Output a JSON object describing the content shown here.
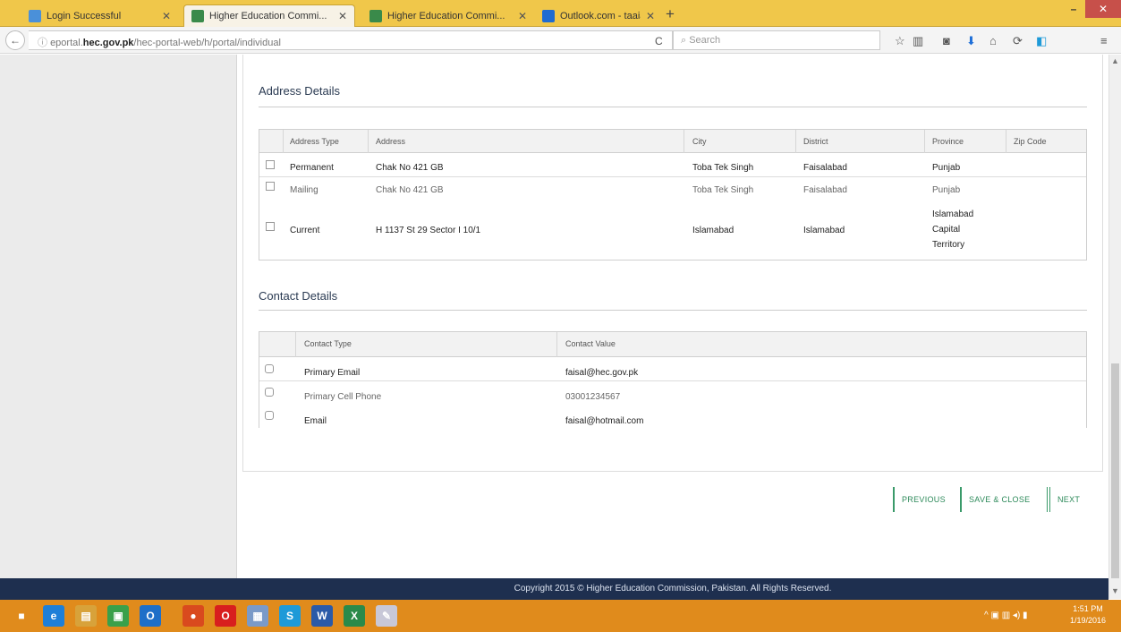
{
  "tabs": [
    {
      "label": "Login Successful",
      "active": false,
      "color": "#4a90d9"
    },
    {
      "label": "Higher Education Commi...",
      "active": true,
      "color": "#3a8a4a"
    },
    {
      "label": "Higher Education Commi...",
      "active": false,
      "color": "#3a8a4a"
    },
    {
      "label": "Outlook.com - taaiaer@ho...",
      "active": false,
      "color": "#1f6bd0"
    }
  ],
  "window": {
    "minimize_label": "–",
    "close_label": "✕"
  },
  "nav": {
    "back_label": "←",
    "url_prefix": "eportal.",
    "url_host": "hec.gov.pk",
    "url_path": "/hec-portal-web/h/portal/individual",
    "reload_label": "C",
    "search_placeholder": "Search"
  },
  "toolbar_icons": [
    "star-icon",
    "reading-list-icon",
    "pocket-icon",
    "download-icon",
    "home-icon",
    "sync-icon",
    "extension-icon",
    "menu-icon"
  ],
  "address": {
    "title": "Address Details",
    "headers": [
      "Address Type",
      "Address",
      "City",
      "District",
      "Province",
      "Zip Code"
    ],
    "rows": [
      {
        "type": "Permanent",
        "address": "Chak No 421 GB",
        "city": "Toba Tek Singh",
        "district": "Faisalabad",
        "province": "Punjab",
        "zip": ""
      },
      {
        "type": "Mailing",
        "address": "Chak No 421 GB",
        "city": "Toba Tek Singh",
        "district": "Faisalabad",
        "province": "Punjab",
        "zip": ""
      },
      {
        "type": "Current",
        "address": "H 1137 St 29 Sector I 10/1",
        "city": "Islamabad",
        "district": "Islamabad",
        "province_line1": "Islamabad",
        "province_line2": "Capital",
        "province_line3": "Territory",
        "zip": ""
      }
    ]
  },
  "contact": {
    "title": "Contact Details",
    "headers": [
      "Contact Type",
      "Contact Value"
    ],
    "rows": [
      {
        "type": "Primary Email",
        "value": "faisal@hec.gov.pk"
      },
      {
        "type": "Primary Cell Phone",
        "value": "03001234567"
      },
      {
        "type": "Email",
        "value": "faisal@hotmail.com"
      }
    ]
  },
  "actions": {
    "previous": "PREVIOUS",
    "save_close": "SAVE & CLOSE",
    "next": "NEXT"
  },
  "footer": {
    "text": "Copyright 2015 © Higher Education Commission, Pakistan. All Rights Reserved."
  },
  "taskbar": {
    "icons": [
      {
        "name": "windows-start-icon",
        "glyph": "■",
        "color": "#e08b1c"
      },
      {
        "name": "internet-explorer-icon",
        "glyph": "e",
        "color": "#1e7fd8"
      },
      {
        "name": "file-explorer-icon",
        "glyph": "▤",
        "color": "#d8a23a"
      },
      {
        "name": "store-icon",
        "glyph": "▣",
        "color": "#3aa04a"
      },
      {
        "name": "outlook-icon",
        "glyph": "O",
        "color": "#1e6fc8"
      },
      {
        "name": "firefox-icon",
        "glyph": "●",
        "color": "#d94a1e"
      },
      {
        "name": "opera-icon",
        "glyph": "O",
        "color": "#d81e1e"
      },
      {
        "name": "notepad-icon",
        "glyph": "▦",
        "color": "#7a9ac8"
      },
      {
        "name": "skype-icon",
        "glyph": "S",
        "color": "#1e9ad8"
      },
      {
        "name": "word-icon",
        "glyph": "W",
        "color": "#2a5aa8"
      },
      {
        "name": "excel-icon",
        "glyph": "X",
        "color": "#2a8a4a"
      },
      {
        "name": "paint-icon",
        "glyph": "✎",
        "color": "#c8c8d8"
      }
    ],
    "tray": "^  ▣  ▥  ◂)  ▮",
    "time": "1:51 PM",
    "date": "1/19/2016"
  }
}
